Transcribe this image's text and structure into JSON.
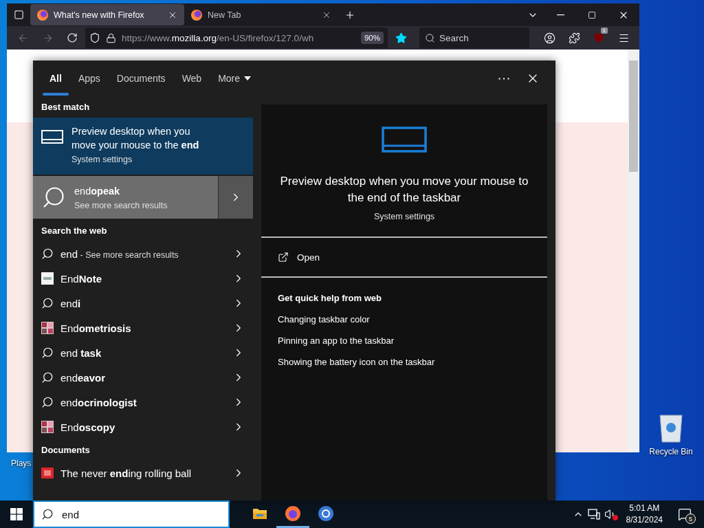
{
  "browser": {
    "tabs": [
      {
        "title": "What's new with Firefox",
        "selected": true
      },
      {
        "title": "New Tab",
        "selected": false
      }
    ],
    "address": {
      "prefix": "https://www.",
      "domain": "mozilla.org",
      "rest": "/en-US/firefox/127.0/wh"
    },
    "zoom": "90%",
    "bookmarked": true,
    "search_placeholder": "Search",
    "extension_badge": "1",
    "back_disabled": true,
    "forward_disabled": true
  },
  "search_panel": {
    "tabs": [
      {
        "label": "All",
        "selected": true,
        "kind": "tab"
      },
      {
        "label": "Apps",
        "selected": false,
        "kind": "tab"
      },
      {
        "label": "Documents",
        "selected": false,
        "kind": "tab"
      },
      {
        "label": "Web",
        "selected": false,
        "kind": "tab"
      },
      {
        "label": "More",
        "selected": false,
        "kind": "menu"
      }
    ],
    "best_match": {
      "header": "Best match",
      "title": "Preview desktop when you move your mouse to the **end**",
      "subtitle": "System settings",
      "selected": true
    },
    "top_search": {
      "title": "end**opeak**",
      "subtitle": "See more search results"
    },
    "web": {
      "header": "Search the web",
      "items": [
        {
          "kind": "search",
          "text": "end",
          "note": "- See more search results"
        },
        {
          "kind": "logo",
          "text": "End**Note**"
        },
        {
          "kind": "search",
          "text": "end**i**"
        },
        {
          "text": "End**ometriosis**"
        },
        {
          "kind": "search",
          "text": "end **task**"
        },
        {
          "kind": "search",
          "text": "end**eavor**"
        },
        {
          "kind": "search",
          "text": "end**ocrinologist**"
        },
        {
          "text": "End**oscopy**"
        }
      ]
    },
    "documents": {
      "header": "Documents",
      "items": [
        {
          "kind": "document",
          "text": "The never **end**ing rolling ball"
        }
      ]
    },
    "preview": {
      "title": "Preview desktop when you move your mouse to the end of the taskbar",
      "subtitle": "System settings",
      "action": "Open",
      "help_header": "Get quick help from web",
      "help_links": [
        "Changing taskbar color",
        "Pinning an app to the taskbar",
        "Showing the battery icon on the taskbar"
      ]
    }
  },
  "taskbar": {
    "search_value": "end",
    "apps": [
      {
        "kind": "folder",
        "active": false
      },
      {
        "kind": "firefox",
        "active": true
      },
      {
        "kind": "chrome",
        "active": false
      }
    ],
    "muted": true,
    "time": "5:01 AM",
    "date": "8/31/2024",
    "notifications": "5"
  },
  "desktop": {
    "icons": [
      {
        "label": "Recycle Bin"
      }
    ],
    "partial_label": "Plays"
  }
}
